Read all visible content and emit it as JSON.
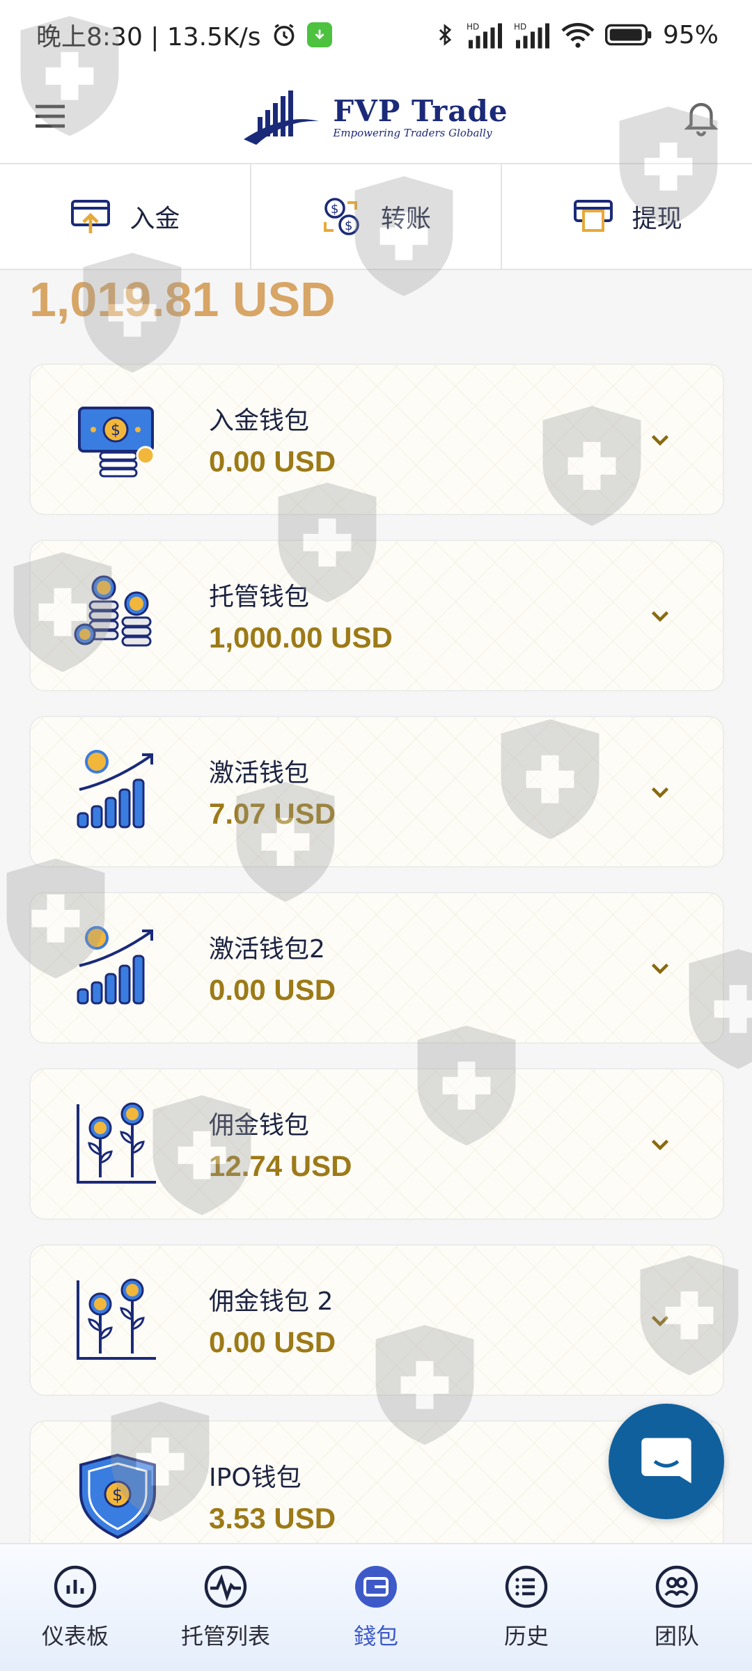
{
  "status_bar": {
    "time_speed": "晚上8:30 | 13.5K/s",
    "battery": "95%",
    "signal_label_1": "HD",
    "signal_label_2": "HD"
  },
  "header": {
    "brand": "FVP Trade",
    "tagline": "Empowering Traders Globally"
  },
  "actions": [
    {
      "label": "入金",
      "icon": "deposit-icon"
    },
    {
      "label": "转账",
      "icon": "transfer-icon"
    },
    {
      "label": "提现",
      "icon": "withdraw-icon"
    }
  ],
  "balance": "1,019.81 USD",
  "wallets": [
    {
      "name": "入金钱包",
      "amount": "0.00 USD",
      "icon": "cash-icon"
    },
    {
      "name": "托管钱包",
      "amount": "1,000.00 USD",
      "icon": "coins-icon"
    },
    {
      "name": "激活钱包",
      "amount": "7.07 USD",
      "icon": "growth-chart-icon"
    },
    {
      "name": "激活钱包2",
      "amount": "0.00 USD",
      "icon": "growth-chart-icon"
    },
    {
      "name": "佣金钱包",
      "amount": "12.74 USD",
      "icon": "money-plant-icon"
    },
    {
      "name": "佣金钱包 2",
      "amount": "0.00 USD",
      "icon": "money-plant-icon"
    },
    {
      "name": "IPO钱包",
      "amount": "3.53 USD",
      "icon": "shield-dollar-icon"
    }
  ],
  "nav": [
    {
      "label": "仪表板",
      "icon": "dashboard-icon"
    },
    {
      "label": "托管列表",
      "icon": "pulse-icon"
    },
    {
      "label": "錢包",
      "icon": "wallet-icon",
      "active": true
    },
    {
      "label": "历史",
      "icon": "list-icon"
    },
    {
      "label": "团队",
      "icon": "team-icon"
    }
  ],
  "colors": {
    "brand": "#1b2a78",
    "balance": "#d7a565",
    "amount": "#9c7a17",
    "active_nav": "#3e59c8",
    "chat_fab": "#11609e"
  }
}
